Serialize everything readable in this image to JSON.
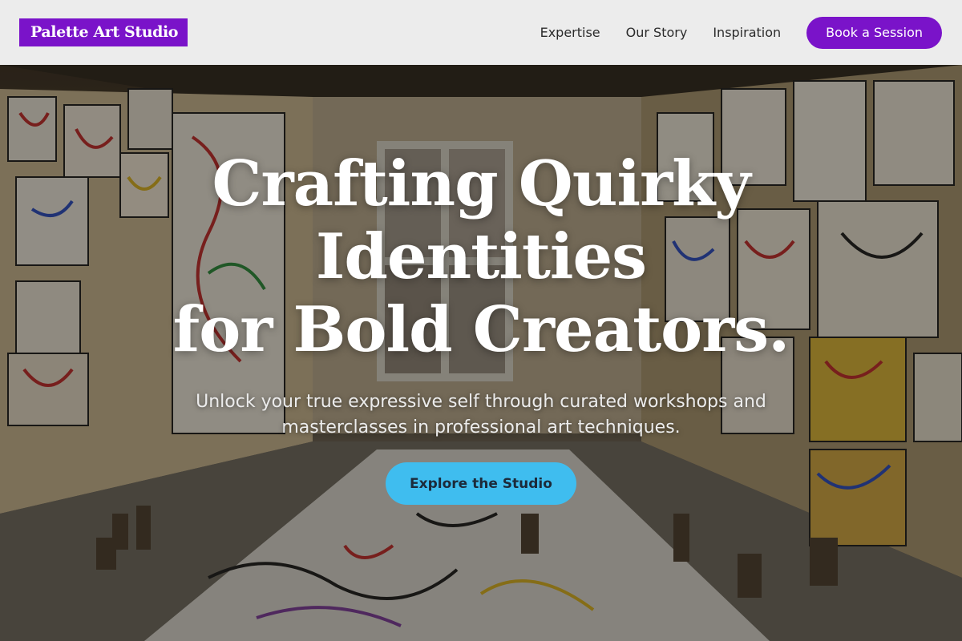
{
  "header": {
    "logo_text": "Palette Art Studio",
    "nav": [
      {
        "label": "Expertise"
      },
      {
        "label": "Our Story"
      },
      {
        "label": "Inspiration"
      }
    ],
    "cta_label": "Book a Session"
  },
  "hero": {
    "headline_lines": [
      "Crafting Quirky",
      "Identities",
      "for Bold Creators."
    ],
    "subtitle": "Unlock your true expressive self through curated workshops and masterclasses in professional art techniques.",
    "cta_label": "Explore the Studio",
    "background_image": "art studio room filled with colorful doodle paintings on walls and floor"
  },
  "colors": {
    "brand_purple": "#7a13c9",
    "cta_blue": "#3fbdef",
    "header_bg": "#ececec"
  }
}
